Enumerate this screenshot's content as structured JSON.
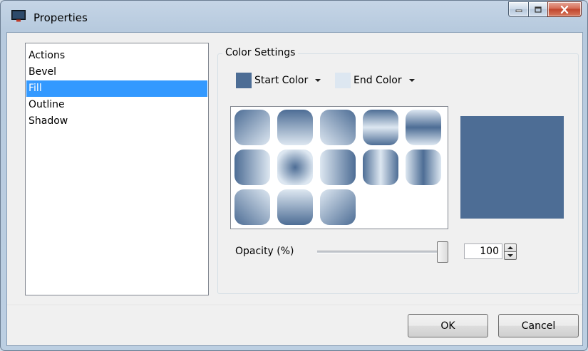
{
  "window": {
    "title": "Properties"
  },
  "sidebar": {
    "items": [
      {
        "label": "Actions",
        "selected": false
      },
      {
        "label": "Bevel",
        "selected": false
      },
      {
        "label": "Fill",
        "selected": true
      },
      {
        "label": "Outline",
        "selected": false
      },
      {
        "label": "Shadow",
        "selected": false
      }
    ]
  },
  "color_settings": {
    "group_label": "Color Settings",
    "start_color": {
      "label": "Start Color",
      "color": "#4d6d95",
      "icon": "chevron-down-icon"
    },
    "end_color": {
      "label": "End Color",
      "color": "#dde7f1",
      "icon": "chevron-down-icon"
    },
    "preview_color": "#4d6d95",
    "gradient_presets": 13
  },
  "opacity": {
    "label": "Opacity (%)",
    "value": "100",
    "slider_fraction": 1.0
  },
  "footer": {
    "ok_label": "OK",
    "cancel_label": "Cancel"
  },
  "colors": {
    "selection": "#3399ff",
    "dark": "#4d6d95",
    "light": "#dde7f1"
  }
}
